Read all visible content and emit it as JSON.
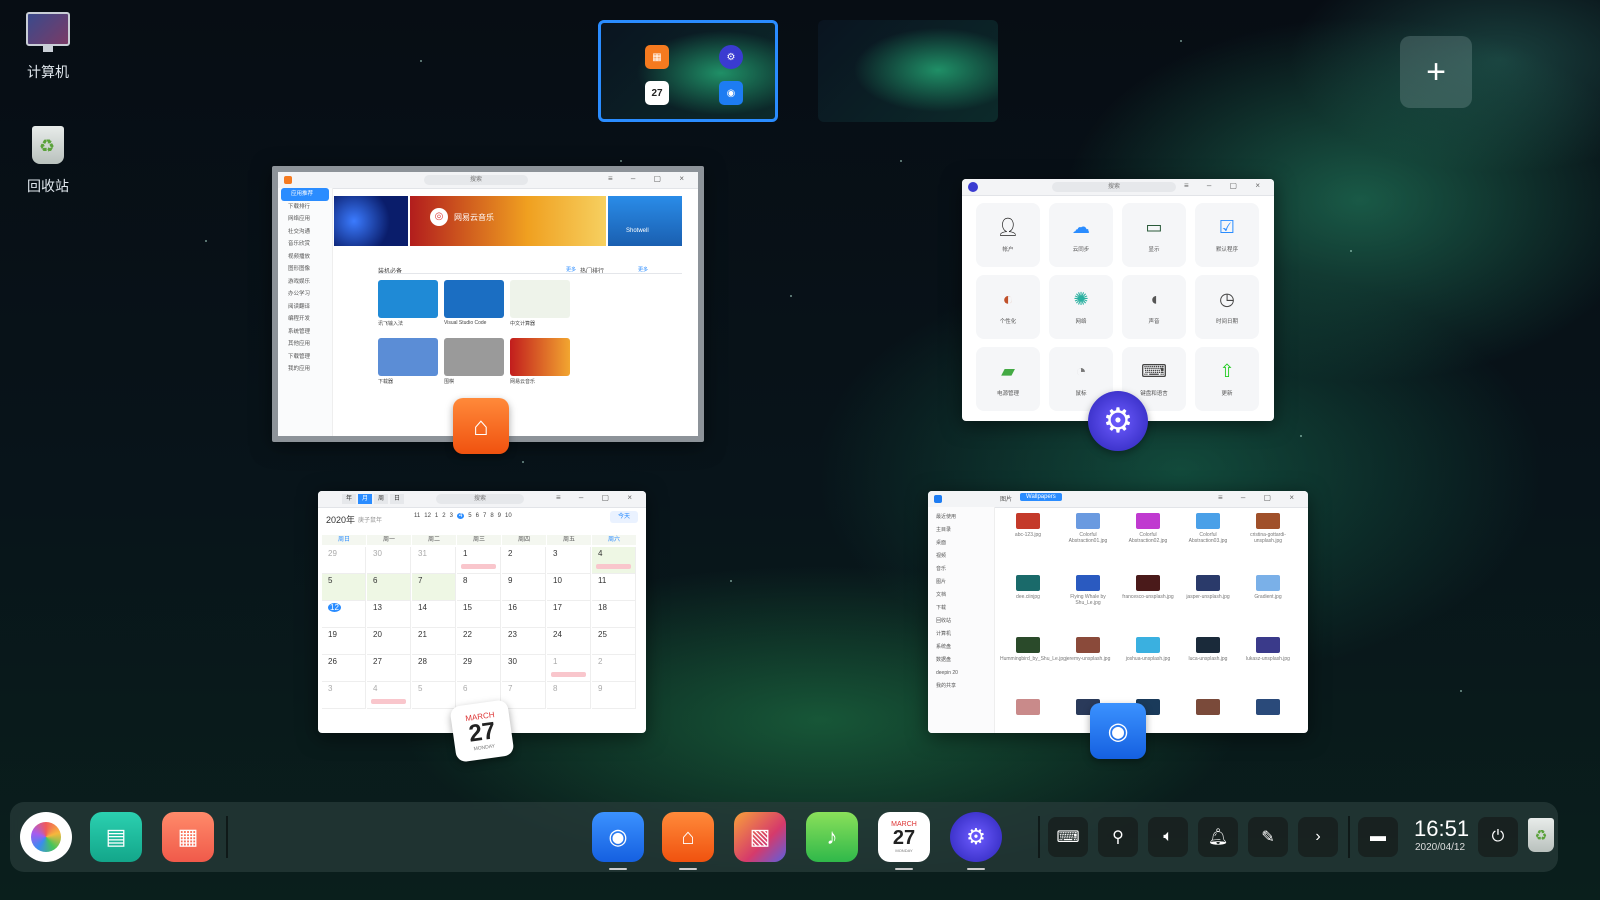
{
  "desktop": {
    "icons": [
      {
        "label": "计算机",
        "icon": "computer-icon"
      },
      {
        "label": "回收站",
        "icon": "trash-icon"
      }
    ]
  },
  "workspaces": {
    "active_index": 0,
    "add_label": "+",
    "ws1_calendar_day": "27"
  },
  "app_store": {
    "search_placeholder": "搜索",
    "sidebar": [
      "应用推荐",
      "下载排行",
      "网络应用",
      "社交沟通",
      "音乐欣赏",
      "视频播放",
      "图形图像",
      "游戏娱乐",
      "办公学习",
      "阅读翻译",
      "编程开发",
      "系统管理",
      "其他应用",
      "下载管理",
      "我的应用"
    ],
    "banner_label": "网易云音乐",
    "banner_side": "Shotwell",
    "section_title": "装机必备",
    "section_more": "更多",
    "section_title_2": "热门排行",
    "section_more_2": "更多",
    "apps": [
      {
        "name": "讯飞输入法",
        "label": "讯飞输入法"
      },
      {
        "name": "Visual Studio Code",
        "label": "Visual Studio Code"
      },
      {
        "name": "中文计算器",
        "label": "中文计算器"
      },
      {
        "name": "下载器",
        "label": "下载器"
      },
      {
        "name": "围棋",
        "label": "围棋"
      },
      {
        "name": "网易云音乐",
        "label": "网易云音乐"
      }
    ]
  },
  "control_center": {
    "search_placeholder": "搜索",
    "modules": [
      {
        "label": "帐户",
        "icon": "account-icon"
      },
      {
        "label": "云同步",
        "icon": "cloud-icon"
      },
      {
        "label": "显示",
        "icon": "display-icon"
      },
      {
        "label": "默认程序",
        "icon": "default-apps-icon"
      },
      {
        "label": "个性化",
        "icon": "personalization-icon"
      },
      {
        "label": "网络",
        "icon": "network-icon"
      },
      {
        "label": "声音",
        "icon": "sound-icon"
      },
      {
        "label": "时间日期",
        "icon": "clock-icon"
      },
      {
        "label": "电源管理",
        "icon": "battery-icon"
      },
      {
        "label": "鼠标",
        "icon": "mouse-icon"
      },
      {
        "label": "键盘和语言",
        "icon": "keyboard-icon"
      },
      {
        "label": "更新",
        "icon": "update-icon"
      }
    ]
  },
  "calendar": {
    "views": [
      "年",
      "月",
      "周",
      "日"
    ],
    "year_label": "2020年",
    "lunar_label": "庚子鼠年",
    "search_placeholder": "搜索",
    "today_button": "今天",
    "week_numbers": [
      "11",
      "12",
      "1",
      "2",
      "3",
      "4",
      "5",
      "6",
      "7",
      "8",
      "9",
      "10"
    ],
    "weekdays": [
      "周日",
      "周一",
      "周二",
      "周三",
      "周四",
      "周五",
      "周六"
    ],
    "rows": [
      [
        "29",
        "30",
        "31",
        "1",
        "2",
        "3",
        "4"
      ],
      [
        "5",
        "6",
        "7",
        "8",
        "9",
        "10",
        "11"
      ],
      [
        "12",
        "13",
        "14",
        "15",
        "16",
        "17",
        "18"
      ],
      [
        "19",
        "20",
        "21",
        "22",
        "23",
        "24",
        "25"
      ],
      [
        "26",
        "27",
        "28",
        "29",
        "30",
        "1",
        "2"
      ],
      [
        "3",
        "4",
        "5",
        "6",
        "7",
        "8",
        "9"
      ]
    ],
    "badge_month": "MARCH",
    "badge_day": "27",
    "badge_weekday": "MONDAY"
  },
  "file_manager": {
    "tabs": [
      "图片",
      "Wallpapers"
    ],
    "sidebar": [
      "最近使用",
      "主目录",
      "桌面",
      "视频",
      "音乐",
      "图片",
      "文档",
      "下载",
      "回收站",
      "计算机",
      "系统盘",
      "数据盘",
      "deepin 20",
      "我的共享"
    ],
    "files": [
      "abc-123.jpg",
      "Colorful Abstraction01.jpg",
      "Colorful Abstraction02.jpg",
      "Colorful Abstraction03.jpg",
      "cristina-gottardi-unsplash.jpg",
      "dee.ciinjpg",
      "Flying Whale by Shu_Le.jpg",
      "francesco-unsplash.jpg",
      "jasper-unsplash.jpg",
      "Gradient.jpg",
      "Hummingbird_by_Shu_Le.jpg",
      "jeremy-unsplash.jpg",
      "joshua-unsplash.jpg",
      "luca-unsplash.jpg",
      "lukasz-unsplash.jpg",
      "",
      "",
      "",
      "",
      ""
    ]
  },
  "dock": {
    "time": "16:51",
    "date": "2020/04/12",
    "apps": [
      {
        "name": "launcher",
        "icon": "launcher-icon"
      },
      {
        "name": "multitasking",
        "icon": "multitask-icon"
      },
      {
        "name": "show-desktop",
        "icon": "desktop-icon"
      },
      {
        "name": "file-manager",
        "icon": "folder-icon"
      },
      {
        "name": "app-store",
        "icon": "store-icon"
      },
      {
        "name": "image-viewer",
        "icon": "photo-icon"
      },
      {
        "name": "music",
        "icon": "music-icon"
      },
      {
        "name": "calendar",
        "icon": "calendar-icon"
      },
      {
        "name": "control-center",
        "icon": "settings-icon"
      }
    ],
    "calendar_month": "MARCH",
    "calendar_day": "27",
    "calendar_weekday": "MONDAY"
  }
}
